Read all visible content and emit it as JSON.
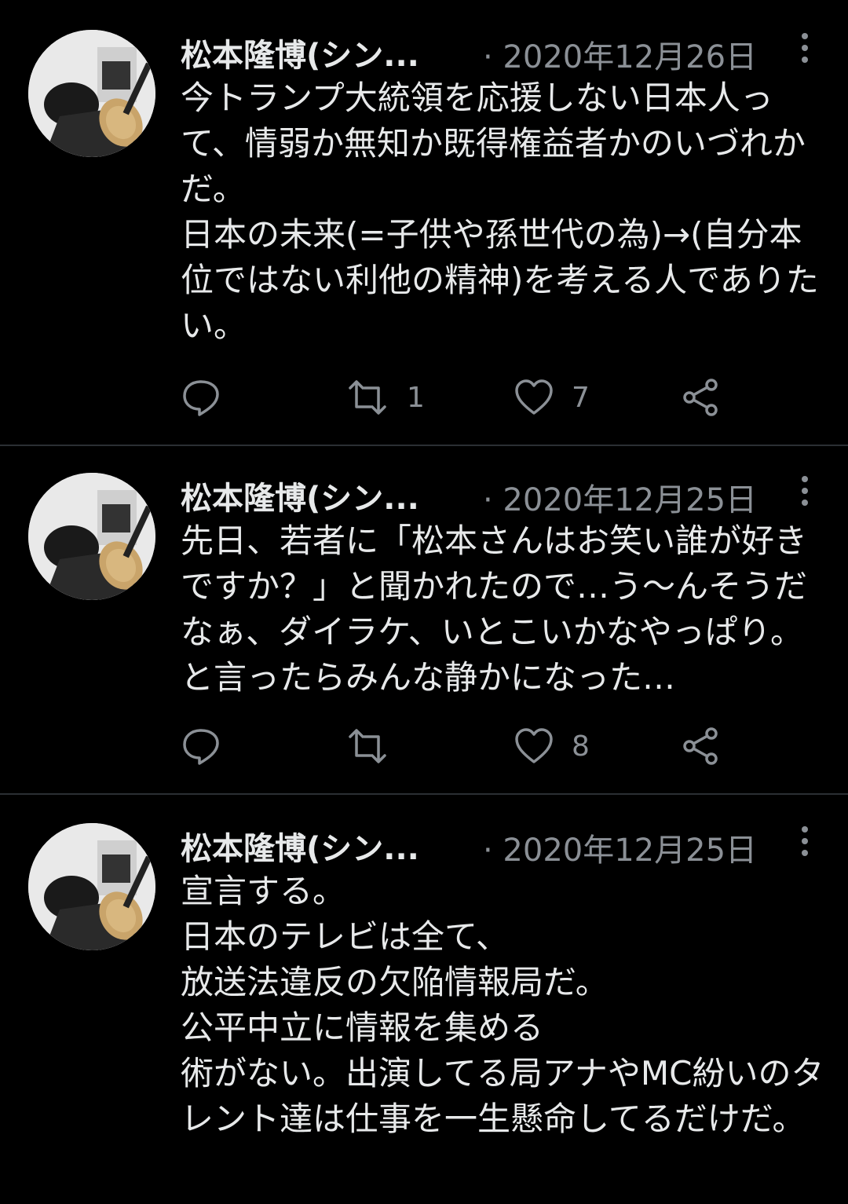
{
  "tweets": [
    {
      "name": "松本隆博(シン...",
      "date": "· 2020年12月26日",
      "text": "今トランプ大統領を応援しない日本人って、情弱か無知か既得権益者かのいづれかだ。\n日本の未来(=子供や孫世代の為)→(自分本位ではない利他の精神)を考える人でありたい。",
      "reply_count": "",
      "retweet_count": "1",
      "like_count": "7"
    },
    {
      "name": "松本隆博(シン...",
      "date": "· 2020年12月25日",
      "text": "先日、若者に「松本さんはお笑い誰が好きですか？」と聞かれたので…う〜んそうだなぁ、ダイラケ、いとこいかなやっぱり。と言ったらみんな静かになった…",
      "reply_count": "",
      "retweet_count": "",
      "like_count": "8"
    },
    {
      "name": "松本隆博(シン...",
      "date": "· 2020年12月25日",
      "text": "宣言する。\n日本のテレビは全て、\n放送法違反の欠陥情報局だ。\n公平中立に情報を集める\n術がない。出演してる局アナやMC紛いのタレント達は仕事を一生懸命してるだけだ。"
    }
  ]
}
